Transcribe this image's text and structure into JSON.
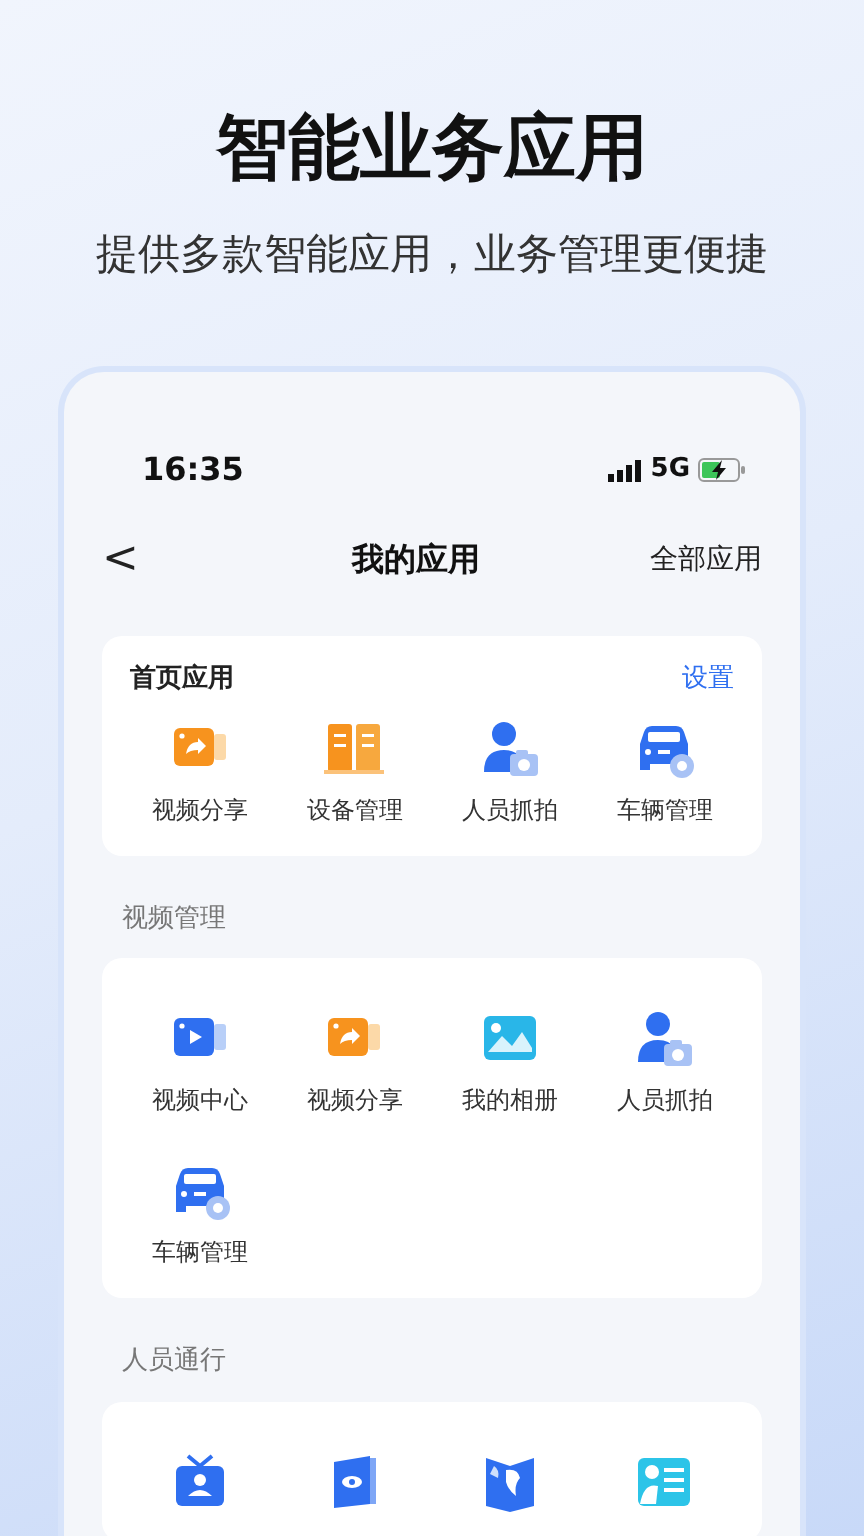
{
  "headline": "智能业务应用",
  "subtitle": "提供多款智能应用，业务管理更便捷",
  "status_bar": {
    "time": "16:35",
    "network": "5G"
  },
  "nav": {
    "back": "<",
    "title": "我的应用",
    "action": "全部应用"
  },
  "home_apps": {
    "title": "首页应用",
    "action": "设置",
    "items": [
      {
        "label": "视频分享",
        "kind": "share"
      },
      {
        "label": "设备管理",
        "kind": "server"
      },
      {
        "label": "人员抓拍",
        "kind": "person"
      },
      {
        "label": "车辆管理",
        "kind": "car"
      }
    ]
  },
  "sections": [
    {
      "title": "视频管理",
      "items": [
        {
          "label": "视频中心",
          "kind": "video"
        },
        {
          "label": "视频分享",
          "kind": "share"
        },
        {
          "label": "我的相册",
          "kind": "album"
        },
        {
          "label": "人员抓拍",
          "kind": "person"
        },
        {
          "label": "车辆管理",
          "kind": "car"
        }
      ]
    },
    {
      "title": "人员通行",
      "items": [
        {
          "kind": "badge"
        },
        {
          "kind": "eye"
        },
        {
          "kind": "map"
        },
        {
          "kind": "panel"
        }
      ]
    }
  ]
}
